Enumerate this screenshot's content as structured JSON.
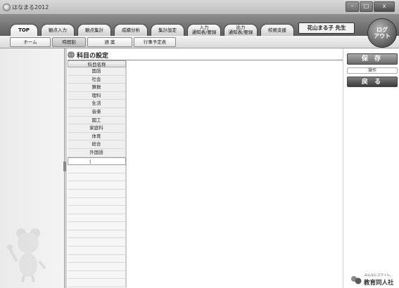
{
  "window": {
    "title": "はなまる2012",
    "controls": {
      "minimize": "–",
      "maximize": "□",
      "close": "x"
    }
  },
  "tabs": [
    {
      "id": "top",
      "label": "TOP",
      "active": true
    },
    {
      "id": "score-input",
      "label": "観点入力"
    },
    {
      "id": "score-total",
      "label": "観点集計"
    },
    {
      "id": "grade-analysis",
      "label": "成績分析"
    },
    {
      "id": "summary-settings",
      "label": "集計設定"
    },
    {
      "id": "input-report",
      "label1": "入力",
      "label2": "通知表/要録"
    },
    {
      "id": "output-report",
      "label1": "出力",
      "label2": "通知表/要録"
    },
    {
      "id": "school-support",
      "label": "校務支援"
    }
  ],
  "user": {
    "name": "花山まる子 先生"
  },
  "logout": {
    "line1": "ログ",
    "line2": "アウト"
  },
  "subnav": [
    {
      "label": "ホーム"
    },
    {
      "label": "時間割",
      "active": true
    },
    {
      "label": "週 案"
    },
    {
      "label": "行事予定表"
    }
  ],
  "section": {
    "title": "科目の設定"
  },
  "subjects": {
    "header": "科目名称",
    "items": [
      "国語",
      "社会",
      "算数",
      "理科",
      "生活",
      "音楽",
      "図工",
      "家庭科",
      "体育",
      "総合",
      "外国語"
    ],
    "input_value": "|"
  },
  "actions": {
    "save": "保 存",
    "operation": "操作",
    "back": "戻 る"
  },
  "brand": {
    "tagline": "みんなにスマイル。",
    "name": "教育同人社"
  },
  "colors": {
    "tabstrip": "#6e6e6e",
    "save": "#8a8a8a",
    "back": "#505050"
  }
}
